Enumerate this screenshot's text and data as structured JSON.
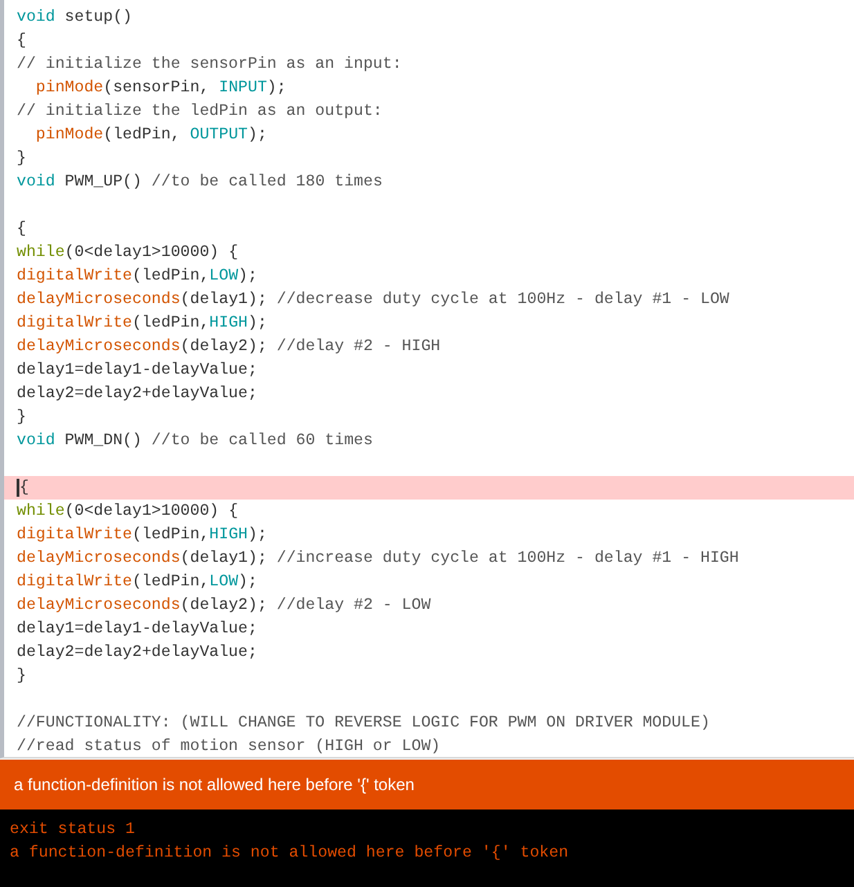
{
  "editor": {
    "lines": [
      {
        "highlighted": false,
        "tokens": [
          {
            "kind": "keyword",
            "text": "void"
          },
          {
            "kind": "plain",
            "text": " setup()"
          }
        ]
      },
      {
        "highlighted": false,
        "tokens": [
          {
            "kind": "plain",
            "text": "{"
          }
        ]
      },
      {
        "highlighted": false,
        "tokens": [
          {
            "kind": "comment",
            "text": "// initialize the sensorPin as an input:"
          }
        ]
      },
      {
        "highlighted": false,
        "indent": true,
        "tokens": [
          {
            "kind": "function",
            "text": "pinMode"
          },
          {
            "kind": "plain",
            "text": "(sensorPin, "
          },
          {
            "kind": "constant",
            "text": "INPUT"
          },
          {
            "kind": "plain",
            "text": ");"
          }
        ]
      },
      {
        "highlighted": false,
        "tokens": [
          {
            "kind": "comment",
            "text": "// initialize the ledPin as an output:"
          }
        ]
      },
      {
        "highlighted": false,
        "indent": true,
        "tokens": [
          {
            "kind": "function",
            "text": "pinMode"
          },
          {
            "kind": "plain",
            "text": "(ledPin, "
          },
          {
            "kind": "constant",
            "text": "OUTPUT"
          },
          {
            "kind": "plain",
            "text": ");"
          }
        ]
      },
      {
        "highlighted": false,
        "tokens": [
          {
            "kind": "plain",
            "text": "}"
          }
        ]
      },
      {
        "highlighted": false,
        "tokens": [
          {
            "kind": "keyword",
            "text": "void"
          },
          {
            "kind": "plain",
            "text": " PWM_UP() "
          },
          {
            "kind": "comment",
            "text": "//to be called 180 times"
          }
        ]
      },
      {
        "highlighted": false
      },
      {
        "highlighted": false,
        "tokens": [
          {
            "kind": "plain",
            "text": "{"
          }
        ]
      },
      {
        "highlighted": false,
        "tokens": [
          {
            "kind": "control",
            "text": "while"
          },
          {
            "kind": "plain",
            "text": "(0<delay1>10000) {"
          }
        ]
      },
      {
        "highlighted": false,
        "tokens": [
          {
            "kind": "function",
            "text": "digitalWrite"
          },
          {
            "kind": "plain",
            "text": "(ledPin,"
          },
          {
            "kind": "constant",
            "text": "LOW"
          },
          {
            "kind": "plain",
            "text": ");"
          }
        ]
      },
      {
        "highlighted": false,
        "tokens": [
          {
            "kind": "function",
            "text": "delayMicroseconds"
          },
          {
            "kind": "plain",
            "text": "(delay1); "
          },
          {
            "kind": "comment",
            "text": "//decrease duty cycle at 100Hz - delay #1 - LOW"
          }
        ]
      },
      {
        "highlighted": false,
        "tokens": [
          {
            "kind": "function",
            "text": "digitalWrite"
          },
          {
            "kind": "plain",
            "text": "(ledPin,"
          },
          {
            "kind": "constant",
            "text": "HIGH"
          },
          {
            "kind": "plain",
            "text": ");"
          }
        ]
      },
      {
        "highlighted": false,
        "tokens": [
          {
            "kind": "function",
            "text": "delayMicroseconds"
          },
          {
            "kind": "plain",
            "text": "(delay2); "
          },
          {
            "kind": "comment",
            "text": "//delay #2 - HIGH"
          }
        ]
      },
      {
        "highlighted": false,
        "tokens": [
          {
            "kind": "plain",
            "text": "delay1=delay1-delayValue;"
          }
        ]
      },
      {
        "highlighted": false,
        "tokens": [
          {
            "kind": "plain",
            "text": "delay2=delay2+delayValue;"
          }
        ]
      },
      {
        "highlighted": false,
        "tokens": [
          {
            "kind": "plain",
            "text": "}"
          }
        ]
      },
      {
        "highlighted": false,
        "tokens": [
          {
            "kind": "keyword",
            "text": "void"
          },
          {
            "kind": "plain",
            "text": " PWM_DN() "
          },
          {
            "kind": "comment",
            "text": "//to be called 60 times"
          }
        ]
      },
      {
        "highlighted": false
      },
      {
        "highlighted": true,
        "tokens": [
          {
            "kind": "plain",
            "text": "{"
          }
        ]
      },
      {
        "highlighted": false,
        "tokens": [
          {
            "kind": "control",
            "text": "while"
          },
          {
            "kind": "plain",
            "text": "(0<delay1>10000) {"
          }
        ]
      },
      {
        "highlighted": false,
        "tokens": [
          {
            "kind": "function",
            "text": "digitalWrite"
          },
          {
            "kind": "plain",
            "text": "(ledPin,"
          },
          {
            "kind": "constant",
            "text": "HIGH"
          },
          {
            "kind": "plain",
            "text": ");"
          }
        ]
      },
      {
        "highlighted": false,
        "tokens": [
          {
            "kind": "function",
            "text": "delayMicroseconds"
          },
          {
            "kind": "plain",
            "text": "(delay1); "
          },
          {
            "kind": "comment",
            "text": "//increase duty cycle at 100Hz - delay #1 - HIGH"
          }
        ]
      },
      {
        "highlighted": false,
        "tokens": [
          {
            "kind": "function",
            "text": "digitalWrite"
          },
          {
            "kind": "plain",
            "text": "(ledPin,"
          },
          {
            "kind": "constant",
            "text": "LOW"
          },
          {
            "kind": "plain",
            "text": ");"
          }
        ]
      },
      {
        "highlighted": false,
        "tokens": [
          {
            "kind": "function",
            "text": "delayMicroseconds"
          },
          {
            "kind": "plain",
            "text": "(delay2); "
          },
          {
            "kind": "comment",
            "text": "//delay #2 - LOW"
          }
        ]
      },
      {
        "highlighted": false,
        "tokens": [
          {
            "kind": "plain",
            "text": "delay1=delay1-delayValue;"
          }
        ]
      },
      {
        "highlighted": false,
        "tokens": [
          {
            "kind": "plain",
            "text": "delay2=delay2+delayValue;"
          }
        ]
      },
      {
        "highlighted": false,
        "tokens": [
          {
            "kind": "plain",
            "text": "}"
          }
        ]
      },
      {
        "highlighted": false
      },
      {
        "highlighted": false,
        "tokens": [
          {
            "kind": "comment",
            "text": "//FUNCTIONALITY: (WILL CHANGE TO REVERSE LOGIC FOR PWM ON DRIVER MODULE)"
          }
        ]
      },
      {
        "highlighted": false,
        "tokens": [
          {
            "kind": "comment",
            "text": "//read status of motion sensor (HIGH or LOW)"
          }
        ]
      }
    ]
  },
  "error_bar": {
    "message": "a function-definition is not allowed here before '{' token"
  },
  "console": {
    "lines": [
      "exit status 1",
      "a function-definition is not allowed here before '{' token"
    ]
  }
}
